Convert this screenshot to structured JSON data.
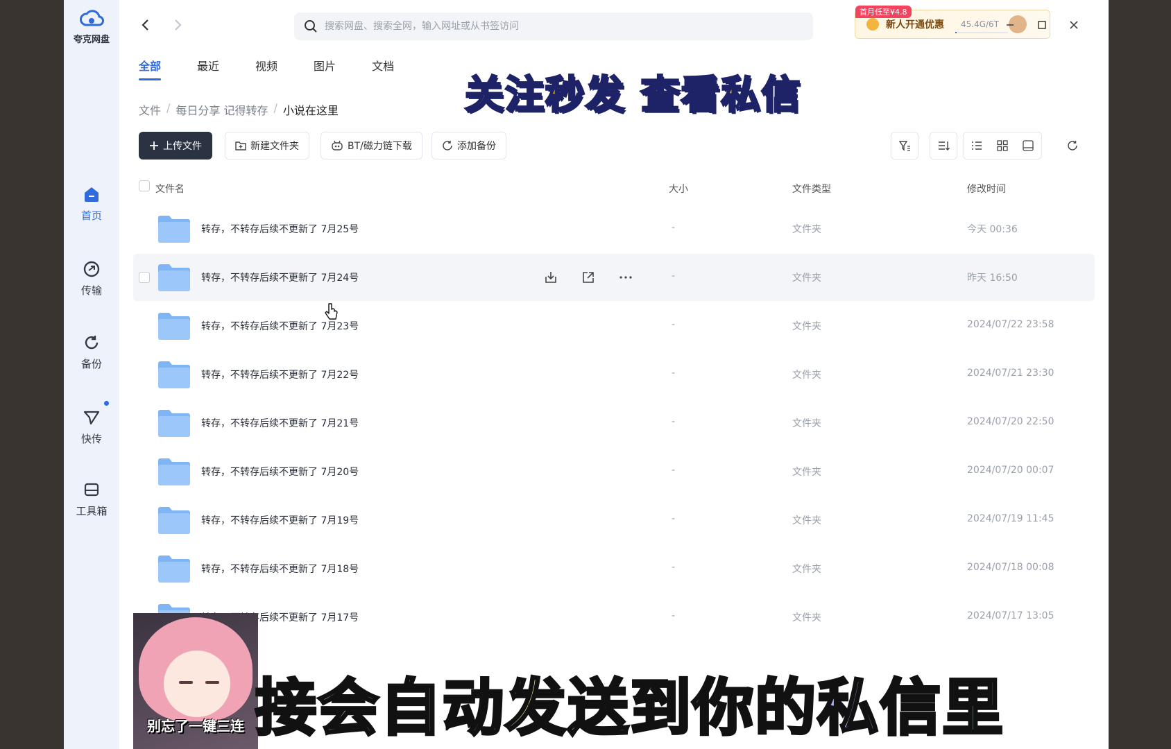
{
  "app": {
    "logo_text": "夸克网盘"
  },
  "sidebar": {
    "items": [
      {
        "label": "首页",
        "icon": "home-icon",
        "active": true
      },
      {
        "label": "传输",
        "icon": "transfer-icon",
        "active": false
      },
      {
        "label": "备份",
        "icon": "backup-icon",
        "active": false
      },
      {
        "label": "快传",
        "icon": "send-icon",
        "active": false,
        "badge_dot": true
      },
      {
        "label": "工具箱",
        "icon": "toolbox-icon",
        "active": false
      }
    ]
  },
  "search": {
    "placeholder": "搜索网盘、搜索全网，输入网址或从书签访问"
  },
  "promo": {
    "tag": "首月低至¥4.8",
    "label": "新人开通优惠",
    "storage": "45.4G/6T",
    "storage_used_fraction": 0.0074
  },
  "tabs": [
    "全部",
    "最近",
    "视频",
    "图片",
    "文档"
  ],
  "breadcrumb": [
    "文件",
    "每日分享 记得转存",
    "小说在这里"
  ],
  "toolbar": {
    "upload": "上传文件",
    "new_folder": "新建文件夹",
    "bt_download": "BT/磁力链下载",
    "add_backup": "添加备份"
  },
  "table": {
    "headers": {
      "name": "文件名",
      "size": "大小",
      "type": "文件类型",
      "modified": "修改时间"
    },
    "rows": [
      {
        "name": "转存，不转存后续不更新了 7月25号",
        "size": "-",
        "type": "文件夹",
        "modified": "今天 00:36"
      },
      {
        "name": "转存，不转存后续不更新了 7月24号",
        "size": "-",
        "type": "文件夹",
        "modified": "昨天 16:50",
        "hover": true
      },
      {
        "name": "转存，不转存后续不更新了 7月23号",
        "size": "-",
        "type": "文件夹",
        "modified": "2024/07/22 23:58"
      },
      {
        "name": "转存，不转存后续不更新了 7月22号",
        "size": "-",
        "type": "文件夹",
        "modified": "2024/07/21 23:30"
      },
      {
        "name": "转存，不转存后续不更新了 7月21号",
        "size": "-",
        "type": "文件夹",
        "modified": "2024/07/20 22:50"
      },
      {
        "name": "转存，不转存后续不更新了 7月20号",
        "size": "-",
        "type": "文件夹",
        "modified": "2024/07/20 00:07"
      },
      {
        "name": "转存，不转存后续不更新了 7月19号",
        "size": "-",
        "type": "文件夹",
        "modified": "2024/07/19 11:45"
      },
      {
        "name": "转存，不转存后续不更新了 7月18号",
        "size": "-",
        "type": "文件夹",
        "modified": "2024/07/18 00:08"
      },
      {
        "name": "转存，不转存后续不更新了 7月17号",
        "size": "-",
        "type": "文件夹",
        "modified": "2024/07/17 13:05"
      }
    ]
  },
  "overlays": {
    "top_banner": "关注秒发 查看私信",
    "bottom_subtitle": "接会自动发送到你的私信里",
    "subtitle_colors": [
      "#ffffff",
      "#ffffff",
      "#f7b6d6",
      "#a9b8f5",
      "#f6e7a8",
      "#b7e6c8",
      "#f5a9a9",
      "#ffffff",
      "#f7b6d6",
      "#a9b8f5",
      "#f6e7a8",
      "#b7e6c8"
    ],
    "cam_caption": "别忘了一键三连"
  }
}
